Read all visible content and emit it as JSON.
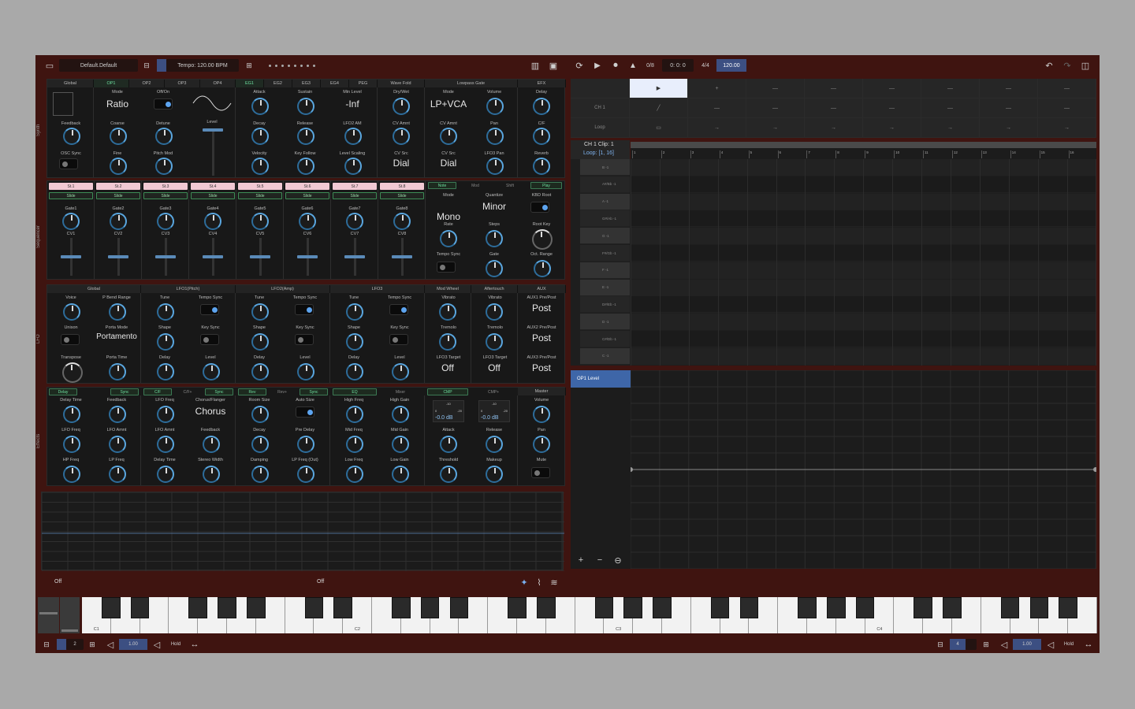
{
  "topbar": {
    "preset": "Default.Default",
    "tempo": "Tempo: 120.00 BPM",
    "position_count": "0/8",
    "time": "0: 0: 0",
    "signature": "4/4",
    "bpm": "120.00"
  },
  "side_labels": {
    "synth": "Synth",
    "sequencer": "Sequencer",
    "lfo": "LFO",
    "effects": "Effects"
  },
  "synth": {
    "tabs": [
      "Global",
      "OP1",
      "OP2",
      "OP3",
      "OP4",
      "EG1",
      "EG2",
      "EG3",
      "EG4",
      "PEG",
      "Wave Fold",
      "Lowpass Gate",
      "EFX"
    ],
    "labels": {
      "feedback": "Feedback",
      "osc_sync": "OSC Sync",
      "mode": "Mode",
      "coarse": "Coarse",
      "fine": "Fine",
      "offon": "Off/On",
      "detune": "Detune",
      "pitch_mod": "Pitch Mod",
      "level": "Level",
      "attack": "Attack",
      "decay": "Decay",
      "velocity": "Velocity",
      "sustain": "Sustain",
      "release": "Release",
      "key_follow": "Key Follow",
      "min_level": "Min Level",
      "lfo2_am": "LFO2 AM",
      "level_scaling": "Level Scaling",
      "drywet": "Dry/Wet",
      "cv_amnt": "CV Amnt",
      "cv_src": "CV Src",
      "lpg_mode": "Mode",
      "lpg_cv_amnt": "CV Amnt",
      "lpg_cv_src": "CV Src",
      "volume": "Volume",
      "pan": "Pan",
      "lfo3_pan": "LFO3 Pan",
      "delay": "Delay",
      "cf": "C/F",
      "reverb": "Reverb"
    },
    "values": {
      "ratio": "Ratio",
      "min_level": "-Inf",
      "cv_src": "Dial",
      "lpg_mode": "LP+VCA",
      "lpg_cv_src": "Dial"
    }
  },
  "sequencer": {
    "steps": [
      "St.1",
      "St.2",
      "St.3",
      "St.4",
      "St.5",
      "St.6",
      "St.7",
      "St.8"
    ],
    "slide": "Slide",
    "gates": [
      "Gate1",
      "Gate2",
      "Gate3",
      "Gate4",
      "Gate5",
      "Gate6",
      "Gate7",
      "Gate8"
    ],
    "cvs": [
      "CV1",
      "CV2",
      "CV3",
      "CV4",
      "CV5",
      "CV6",
      "CV7",
      "CV8"
    ],
    "tabs": [
      "Note",
      "Mod",
      "Shift",
      "Play"
    ],
    "labels": {
      "mode": "Mode",
      "quantize": "Quantize",
      "kbd_root": "KBD Root",
      "rate": "Rate",
      "steps": "Steps",
      "root_key": "Root Key",
      "tempo_sync": "Tempo Sync",
      "gate": "Gate",
      "oct_range": "Oct. Range"
    },
    "values": {
      "mode": "Mono",
      "quantize": "Minor"
    }
  },
  "lfo": {
    "headers": [
      "Global",
      "LFO1(Pitch)",
      "LFO2(Amp)",
      "LFO3",
      "Mod Wheel",
      "Aftertouch",
      "AUX"
    ],
    "global": {
      "voice": "Voice",
      "pbend": "P Bend Range",
      "unison": "Unison",
      "porta_mode": "Porta Mode",
      "porta_value": "Portamento",
      "transpose": "Transpose",
      "porta_time": "Porta Time"
    },
    "lfo_labels": {
      "tune": "Tune",
      "tempo_sync": "Tempo Sync",
      "shape": "Shape",
      "key_sync": "Key Sync",
      "delay": "Delay",
      "level": "Level"
    },
    "mod": {
      "vibrato": "Vibrato",
      "tremolo": "Tremolo",
      "lfo3_target": "LFO3 Target",
      "off": "Off"
    },
    "aux": {
      "aux1": "AUX1 Pre/Post",
      "aux2": "AUX2 Pre/Post",
      "aux3": "AUX3 Pre/Post",
      "post": "Post"
    }
  },
  "effects": {
    "tabs": [
      "Delay",
      "Sync",
      "C/F",
      "C/F+",
      "Sync",
      "Rev",
      "Rev+",
      "Sync",
      "EQ",
      "Mixer",
      "CMP",
      "CMP+",
      "Master"
    ],
    "delay": {
      "time": "Delay Time",
      "feedback": "Feedback",
      "lfo_freq": "LFO Freq",
      "lfo_amnt": "LFO Amnt",
      "hp": "HP Freq",
      "lp": "LP Freq"
    },
    "cf": {
      "lfo_freq": "LFO Freq",
      "chorus_flanger": "Chorus/Flanger",
      "chorus": "Chorus",
      "lfo_amnt": "LFO Amnt",
      "feedback": "Feedback",
      "delay_time": "Delay Time",
      "stereo": "Stereo Width"
    },
    "rev": {
      "room": "Room Size",
      "auto": "Auto Size",
      "decay": "Decay",
      "pre": "Pre Delay",
      "damping": "Damping",
      "lp": "LP Freq (Out)"
    },
    "eq": {
      "high_freq": "High Freq",
      "high_gain": "High Gain",
      "mid_freq": "Mid Freq",
      "mid_gain": "Mid Gain",
      "low_freq": "Low Freq",
      "low_gain": "Low Gain"
    },
    "cmp": {
      "db1": "-0.0 dB",
      "db2": "-0.0 dB",
      "attack": "Attack",
      "release": "Release",
      "threshold": "Threshold",
      "makeup": "Makeup",
      "s0": "0",
      "s10": "-10",
      "s20": "-20"
    },
    "master": {
      "volume": "Volume",
      "pan": "Pan",
      "mute": "Mute"
    }
  },
  "footer": {
    "off_left": "Off",
    "off_right": "Off"
  },
  "keyboard": {
    "labels": [
      "C1",
      "C2",
      "C3",
      "C4"
    ]
  },
  "bottombar": {
    "left_oct": "2",
    "left_vel": "1.00",
    "hold": "Hold",
    "right_oct": "4",
    "right_vel": "1.00"
  },
  "clips": {
    "channel": "CH 1",
    "loop": "Loop",
    "clip_title": "CH 1 Clip: 1",
    "clip_loop": "Loop: [1, 16]",
    "dash": "—",
    "plus": "+",
    "arrow": "→",
    "ruler": [
      "1",
      "2",
      "3",
      "4",
      "5",
      "6",
      "7",
      "8",
      "9",
      "10",
      "11",
      "12",
      "13",
      "14",
      "15",
      "16"
    ],
    "notes": [
      "B -1",
      "A#/Bb -1",
      "A -1",
      "G#/Ab -1",
      "G -1",
      "F#/Gb -1",
      "F -1",
      "E -1",
      "D#/Eb -1",
      "D -1",
      "C#/Db -1",
      "C -1"
    ],
    "automation": "OP1 Level"
  }
}
